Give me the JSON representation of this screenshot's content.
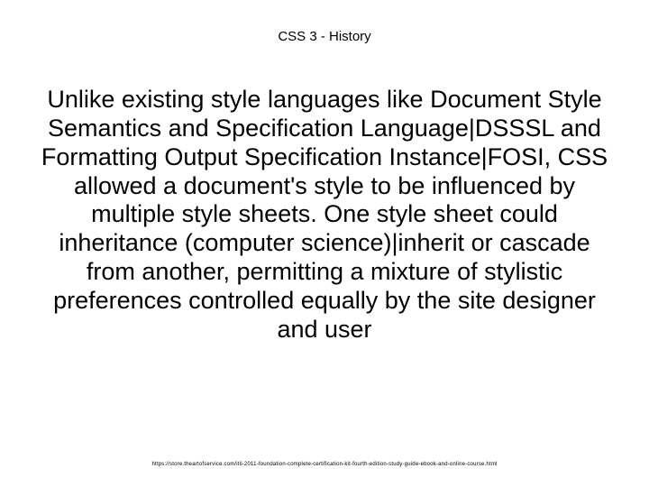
{
  "slide": {
    "title": "CSS 3 - History",
    "body": "Unlike existing style languages like Document Style Semantics and Specification Language|DSSSL and Formatting Output Specification Instance|FOSI, CSS allowed a document's style to be influenced by multiple style sheets. One style sheet could inheritance (computer science)|inherit or cascade from another, permitting a mixture of stylistic preferences controlled equally by the site designer and user",
    "footer": "https://store.theartofservice.com/itil-2011-foundation-complete-certification-kit-fourth-edition-study-guide-ebook-and-online-course.html"
  }
}
